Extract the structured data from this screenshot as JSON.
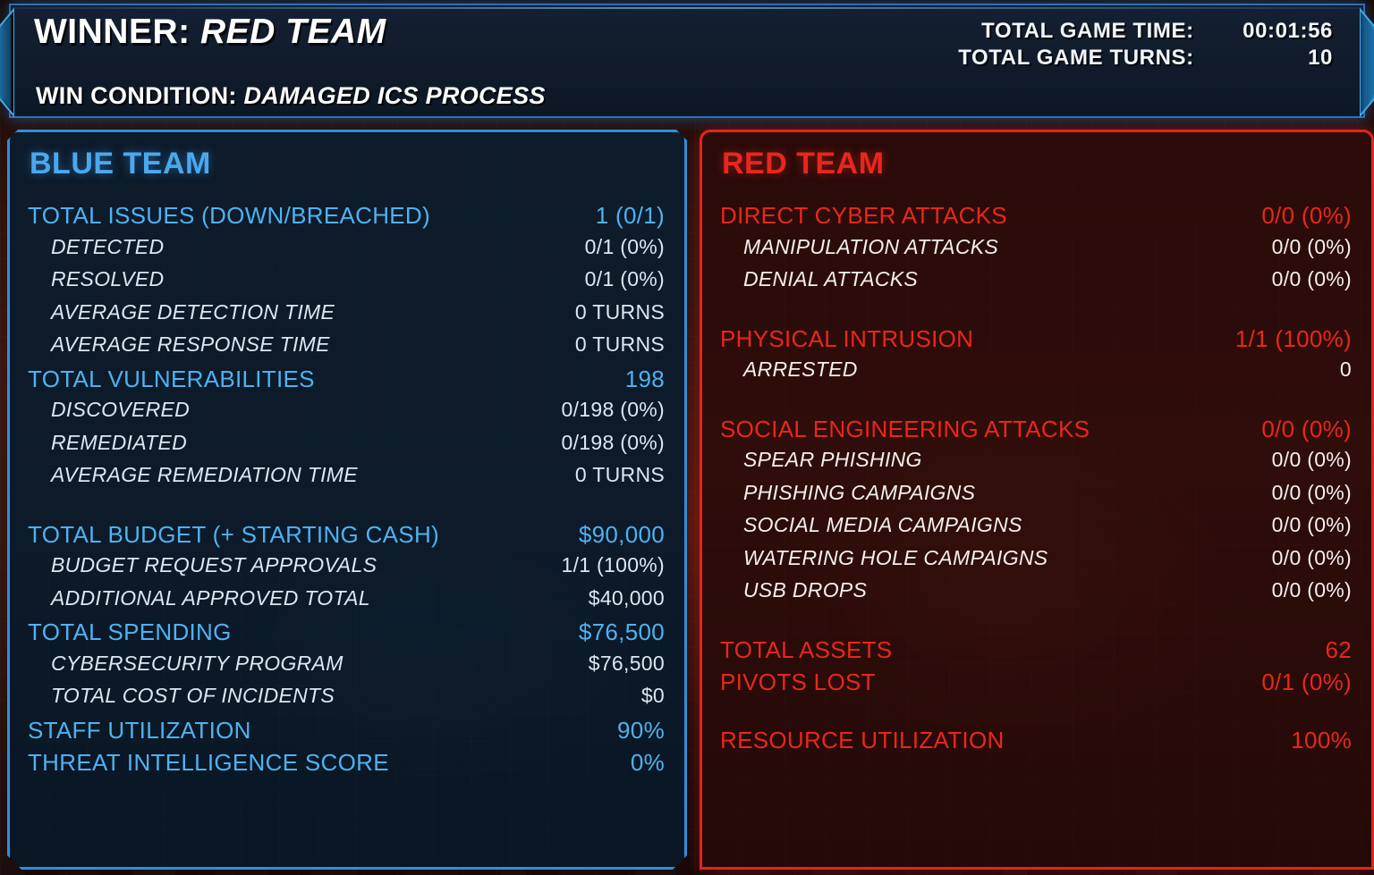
{
  "header": {
    "winner_label": "WINNER:",
    "winner_value": "RED TEAM",
    "win_condition_label": "WIN CONDITION:",
    "win_condition_value": "DAMAGED ICS PROCESS",
    "total_game_time_label": "TOTAL GAME TIME:",
    "total_game_time_value": "00:01:56",
    "total_game_turns_label": "TOTAL GAME TURNS:",
    "total_game_turns_value": "10"
  },
  "colors": {
    "blue_accent": "#4fb2f0",
    "blue_border": "#2f8fd8",
    "blue_panel_bg": "#0c1a2a",
    "red_accent": "#e8271c",
    "red_border": "#e3241b",
    "red_panel_bg": "#2e0d0a",
    "header_bg": "#101b2b",
    "text_light": "#dbe7f1",
    "text_white": "#ffffff",
    "page_bg": "#2a100c"
  },
  "blue_team": {
    "title": "BLUE TEAM",
    "rows": [
      {
        "level": "head",
        "label": "TOTAL ISSUES (DOWN/BREACHED)",
        "value": "1 (0/1)",
        "gap": false
      },
      {
        "level": "sub",
        "label": "DETECTED",
        "value": "0/1 (0%)",
        "gap": false
      },
      {
        "level": "sub",
        "label": "RESOLVED",
        "value": "0/1 (0%)",
        "gap": false
      },
      {
        "level": "sub",
        "label": "AVERAGE DETECTION TIME",
        "value": "0 TURNS",
        "gap": false
      },
      {
        "level": "sub",
        "label": "AVERAGE RESPONSE TIME",
        "value": "0 TURNS",
        "gap": false
      },
      {
        "level": "head",
        "label": "TOTAL VULNERABILITIES",
        "value": "198",
        "gap": false
      },
      {
        "level": "sub",
        "label": "DISCOVERED",
        "value": "0/198 (0%)",
        "gap": false
      },
      {
        "level": "sub",
        "label": "REMEDIATED",
        "value": "0/198 (0%)",
        "gap": false
      },
      {
        "level": "sub",
        "label": "AVERAGE REMEDIATION TIME",
        "value": "0 TURNS",
        "gap": false
      },
      {
        "level": "head",
        "label": "TOTAL BUDGET (+ STARTING CASH)",
        "value": "$90,000",
        "gap": true
      },
      {
        "level": "sub",
        "label": "BUDGET REQUEST APPROVALS",
        "value": "1/1 (100%)",
        "gap": false
      },
      {
        "level": "sub",
        "label": "ADDITIONAL APPROVED TOTAL",
        "value": "$40,000",
        "gap": false
      },
      {
        "level": "head",
        "label": "TOTAL SPENDING",
        "value": "$76,500",
        "gap": false
      },
      {
        "level": "sub",
        "label": "CYBERSECURITY PROGRAM",
        "value": "$76,500",
        "gap": false
      },
      {
        "level": "sub",
        "label": "TOTAL COST OF INCIDENTS",
        "value": "$0",
        "gap": false
      },
      {
        "level": "head",
        "label": "STAFF UTILIZATION",
        "value": "90%",
        "gap": false
      },
      {
        "level": "head",
        "label": "THREAT INTELLIGENCE SCORE",
        "value": "0%",
        "gap": false
      }
    ]
  },
  "red_team": {
    "title": "RED TEAM",
    "rows": [
      {
        "level": "head",
        "label": "DIRECT CYBER ATTACKS",
        "value": "0/0 (0%)",
        "gap": false
      },
      {
        "level": "sub",
        "label": "MANIPULATION ATTACKS",
        "value": "0/0 (0%)",
        "gap": false
      },
      {
        "level": "sub",
        "label": "DENIAL ATTACKS",
        "value": "0/0 (0%)",
        "gap": false
      },
      {
        "level": "head",
        "label": "PHYSICAL INTRUSION",
        "value": "1/1 (100%)",
        "gap": true
      },
      {
        "level": "sub",
        "label": "ARRESTED",
        "value": "0",
        "gap": false
      },
      {
        "level": "head",
        "label": "SOCIAL ENGINEERING ATTACKS",
        "value": "0/0 (0%)",
        "gap": true
      },
      {
        "level": "sub",
        "label": "SPEAR PHISHING",
        "value": "0/0 (0%)",
        "gap": false
      },
      {
        "level": "sub",
        "label": "PHISHING CAMPAIGNS",
        "value": "0/0 (0%)",
        "gap": false
      },
      {
        "level": "sub",
        "label": "SOCIAL MEDIA CAMPAIGNS",
        "value": "0/0 (0%)",
        "gap": false
      },
      {
        "level": "sub",
        "label": "WATERING HOLE CAMPAIGNS",
        "value": "0/0 (0%)",
        "gap": false
      },
      {
        "level": "sub",
        "label": "USB DROPS",
        "value": "0/0 (0%)",
        "gap": false
      },
      {
        "level": "head",
        "label": "TOTAL ASSETS",
        "value": "62",
        "gap": true
      },
      {
        "level": "head",
        "label": "PIVOTS LOST",
        "value": "0/1 (0%)",
        "gap": false
      },
      {
        "level": "head",
        "label": "RESOURCE UTILIZATION",
        "value": "100%",
        "gap": true
      }
    ]
  }
}
